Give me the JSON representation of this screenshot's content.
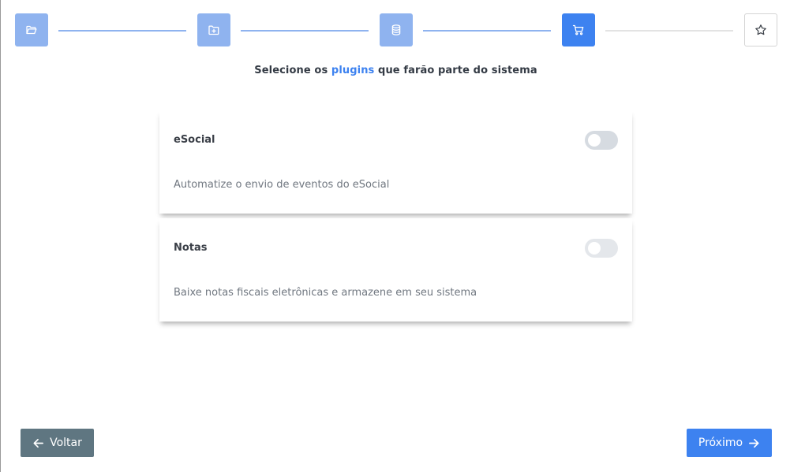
{
  "stepper": {
    "steps": [
      {
        "icon": "folder-open-icon",
        "state": "done"
      },
      {
        "icon": "folder-plus-icon",
        "state": "done"
      },
      {
        "icon": "database-icon",
        "state": "done"
      },
      {
        "icon": "shopping-cart-icon",
        "state": "active"
      },
      {
        "icon": "star-icon",
        "state": "pending"
      }
    ],
    "colors": {
      "done": "#8fb3ef",
      "active": "#3d82f0",
      "pending_border": "#d4d4d4"
    }
  },
  "heading": {
    "prefix": "Selecione os",
    "highlight": "plugins",
    "suffix": "que farão parte do sistema"
  },
  "plugins": [
    {
      "title": "eSocial",
      "description": "Automatize o envio de eventos do eSocial",
      "enabled": false
    },
    {
      "title": "Notas",
      "description": "Baixe notas fiscais eletrônicas e armazene em seu sistema",
      "enabled": false
    }
  ],
  "buttons": {
    "back_label": "Voltar",
    "next_label": "Próximo"
  },
  "colors": {
    "accent": "#3d82f0",
    "back_button": "#5f7681"
  }
}
